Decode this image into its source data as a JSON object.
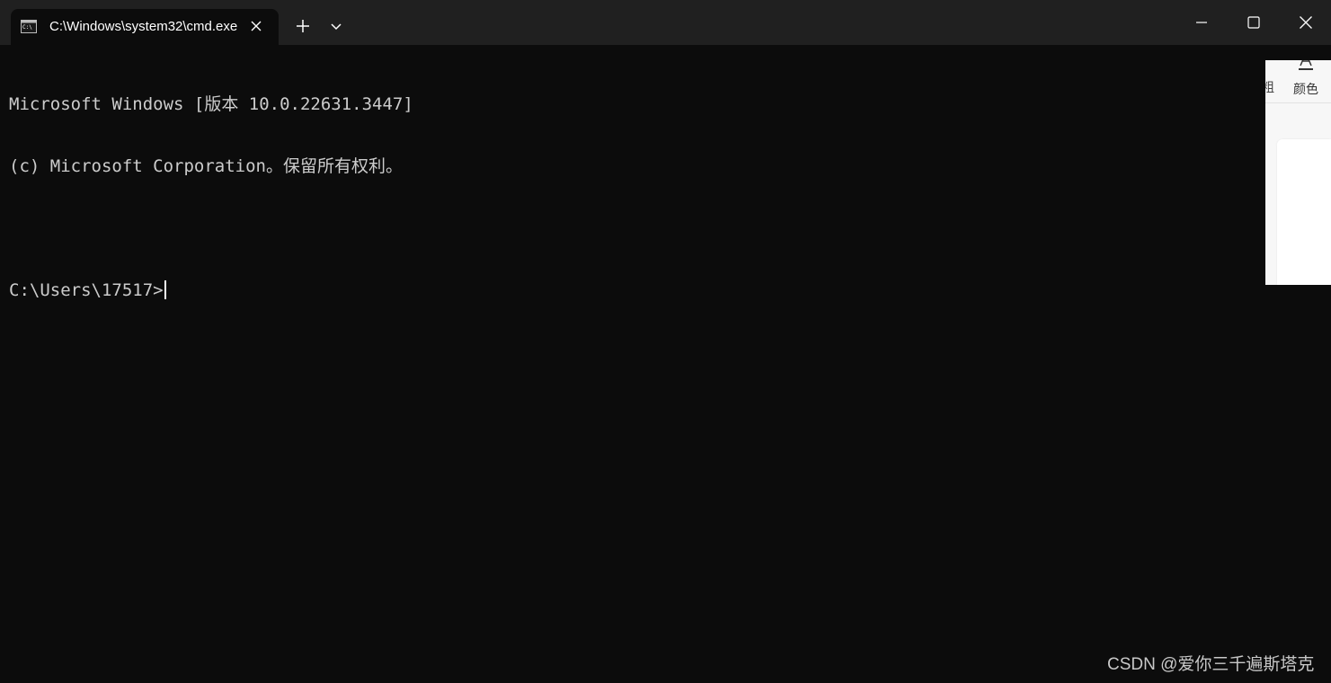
{
  "tab": {
    "title": "C:\\Windows\\system32\\cmd.exe",
    "icon": "cmd-icon"
  },
  "tabbar": {
    "new_tab_icon": "plus-icon",
    "dropdown_icon": "chevron-down-icon"
  },
  "window_controls": {
    "minimize_icon": "minimize-icon",
    "maximize_icon": "maximize-icon",
    "close_icon": "close-icon"
  },
  "terminal": {
    "lines": [
      "Microsoft Windows [版本 10.0.22631.3447]",
      "(c) Microsoft Corporation。保留所有权利。",
      "",
      "C:\\Users\\17517>"
    ]
  },
  "side_panel": {
    "partial_text": "粗",
    "color_label": "颜色",
    "color_icon": "font-color-icon"
  },
  "watermark": "CSDN @爱你三千遍斯塔克",
  "colors": {
    "terminal_bg": "#0c0c0c",
    "tabbar_bg": "#202020",
    "terminal_text": "#cccccc"
  }
}
